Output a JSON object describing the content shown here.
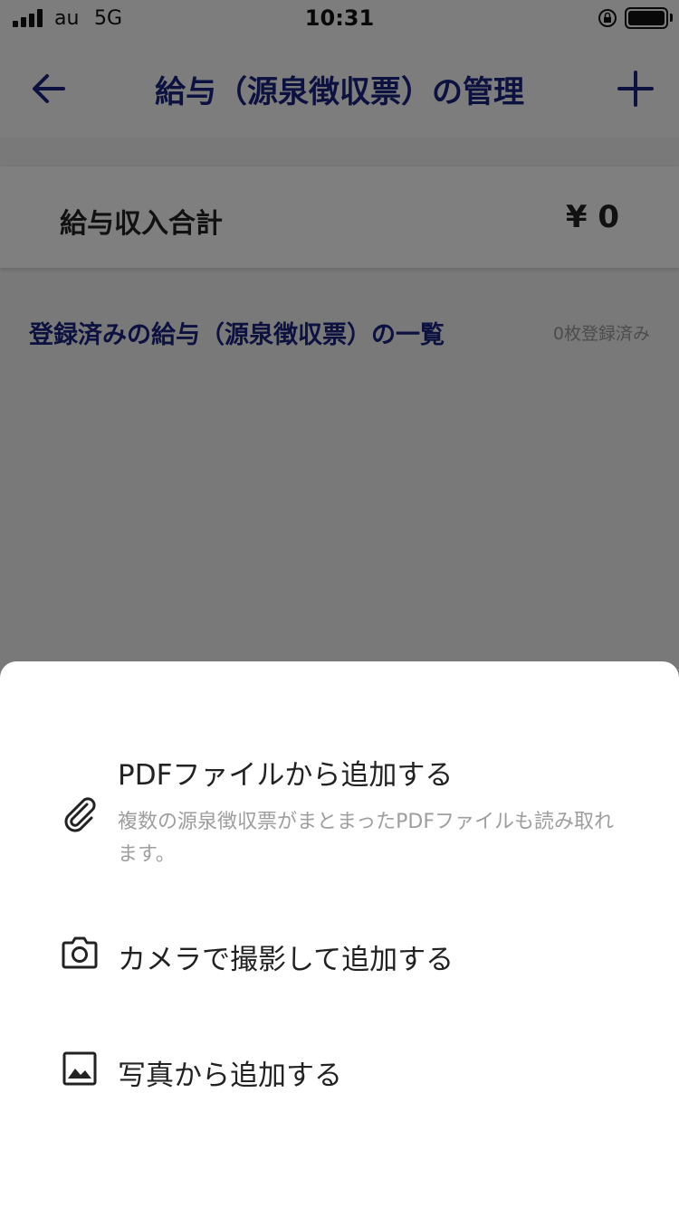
{
  "status_bar": {
    "carrier": "au",
    "network": "5G",
    "time": "10:31"
  },
  "header": {
    "title": "給与（源泉徴収票）の管理",
    "back_icon": "arrow-left-icon",
    "add_icon": "plus-icon"
  },
  "summary": {
    "label": "給与収入合計",
    "value": "¥ 0"
  },
  "list": {
    "heading": "登録済みの給与（源泉徴収票）の一覧",
    "count": "0枚登録済み"
  },
  "sheet": {
    "options": [
      {
        "icon": "paperclip-icon",
        "label": "PDFファイルから追加する",
        "description": "複数の源泉徴収票がまとまったPDFファイルも読み取れます。"
      },
      {
        "icon": "camera-icon",
        "label": "カメラで撮影して追加する"
      },
      {
        "icon": "image-icon",
        "label": "写真から追加する"
      }
    ]
  },
  "colors": {
    "accent": "#1a237e",
    "overlay": "#000000"
  }
}
